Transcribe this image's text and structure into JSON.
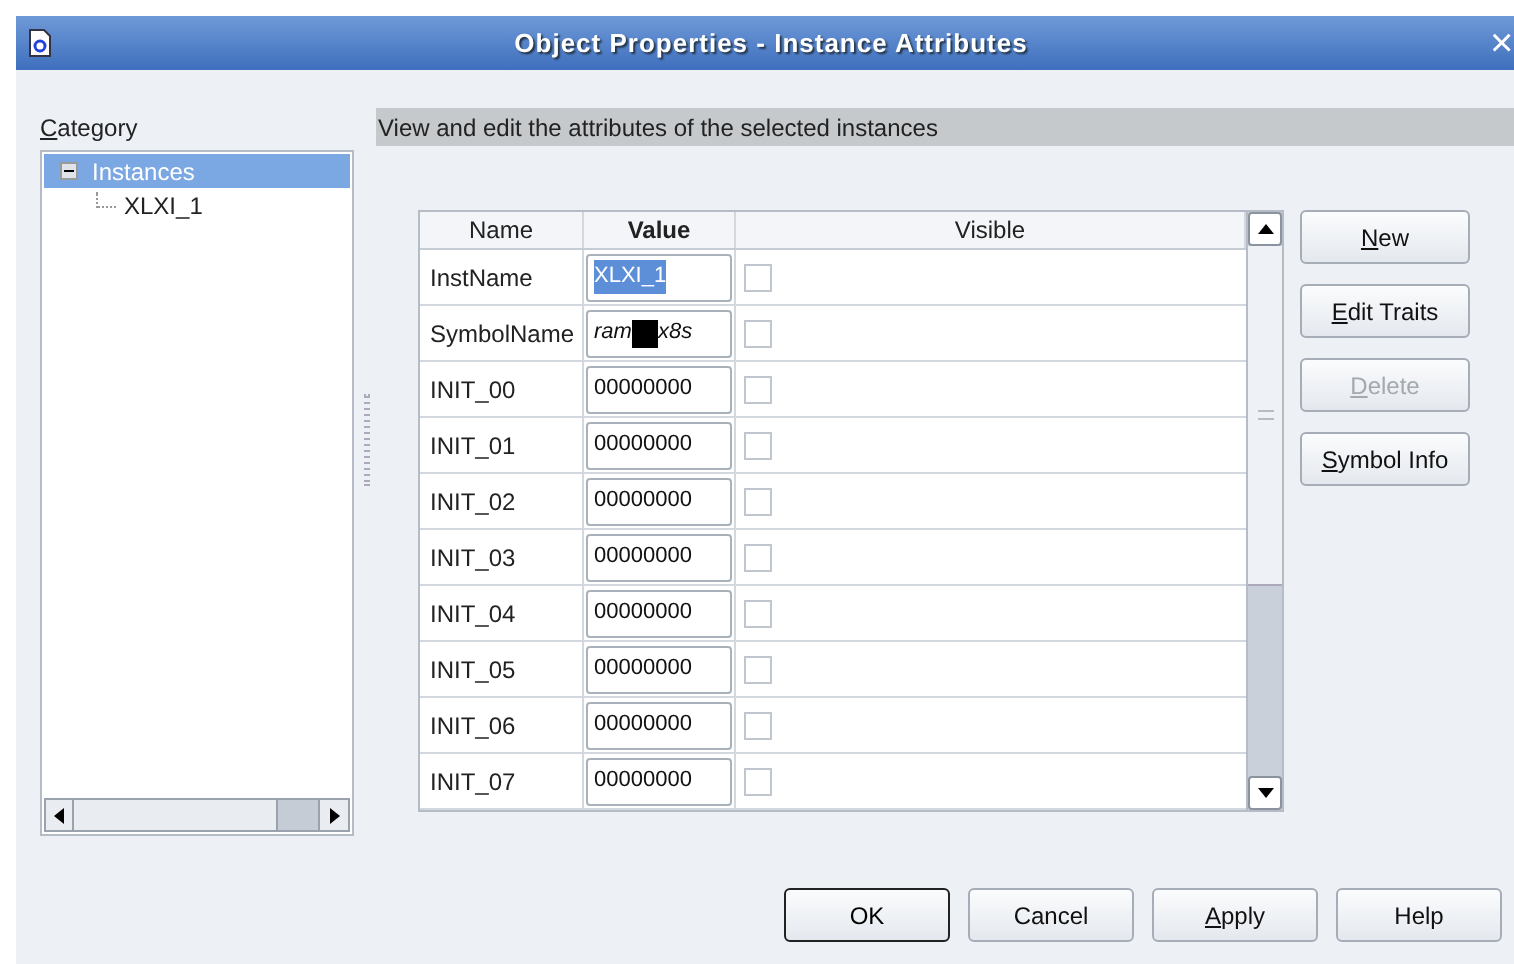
{
  "window": {
    "title": "Object Properties - Instance Attributes",
    "close": "×"
  },
  "category": {
    "label": "Category",
    "mnemonic": true,
    "tree": [
      {
        "label": "Instances",
        "selected": true,
        "expanded": true,
        "children": [
          {
            "label": "XLXI_1",
            "selected": false
          }
        ]
      }
    ]
  },
  "description": "View and edit the attributes of the selected instances",
  "table": {
    "columns": [
      "Name",
      "Value",
      "Visible"
    ],
    "rows": [
      {
        "name": "InstName",
        "value": "XLXI_1",
        "value_selected": true,
        "italic": false,
        "visible": false
      },
      {
        "name": "SymbolName",
        "value": "ram",
        "redacted": true,
        "value_after": "x8s",
        "value_selected": false,
        "italic": true,
        "visible": false
      },
      {
        "name": "INIT_00",
        "value": "00000000",
        "value_selected": false,
        "italic": false,
        "visible": false
      },
      {
        "name": "INIT_01",
        "value": "00000000",
        "value_selected": false,
        "italic": false,
        "visible": false
      },
      {
        "name": "INIT_02",
        "value": "00000000",
        "value_selected": false,
        "italic": false,
        "visible": false
      },
      {
        "name": "INIT_03",
        "value": "00000000",
        "value_selected": false,
        "italic": false,
        "visible": false
      },
      {
        "name": "INIT_04",
        "value": "00000000",
        "value_selected": false,
        "italic": false,
        "visible": false
      },
      {
        "name": "INIT_05",
        "value": "00000000",
        "value_selected": false,
        "italic": false,
        "visible": false
      },
      {
        "name": "INIT_06",
        "value": "00000000",
        "value_selected": false,
        "italic": false,
        "visible": false
      },
      {
        "name": "INIT_07",
        "value": "00000000",
        "value_selected": false,
        "italic": false,
        "visible": false
      }
    ]
  },
  "side_buttons": [
    {
      "label": "New",
      "mnemonic": true,
      "disabled": false
    },
    {
      "label": "Edit Traits",
      "mnemonic": true,
      "disabled": false
    },
    {
      "label": "Delete",
      "mnemonic": true,
      "disabled": true
    },
    {
      "label": "Symbol Info",
      "mnemonic": true,
      "disabled": false
    }
  ],
  "bottom_buttons": [
    {
      "label": "OK",
      "mnemonic": false,
      "default": true
    },
    {
      "label": "Cancel",
      "mnemonic": false,
      "default": false
    },
    {
      "label": "Apply",
      "mnemonic": true,
      "default": false
    },
    {
      "label": "Help",
      "mnemonic": false,
      "default": false
    }
  ]
}
